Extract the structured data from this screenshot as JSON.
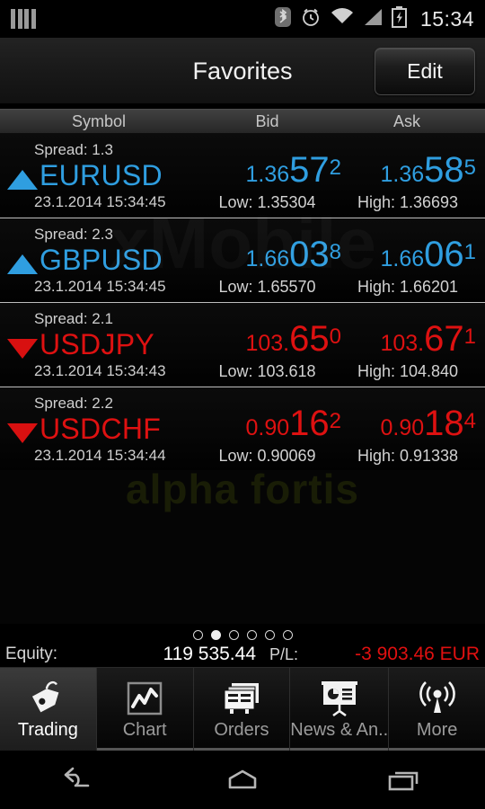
{
  "statusbar": {
    "left_icon": "signal-bars-icon",
    "icons": [
      "bluetooth-icon",
      "alarm-icon",
      "wifi-icon",
      "cell-signal-icon",
      "battery-charging-icon"
    ],
    "clock": "15:34"
  },
  "header": {
    "title": "Favorites",
    "edit_label": "Edit"
  },
  "columns": {
    "symbol": "Symbol",
    "bid": "Bid",
    "ask": "Ask"
  },
  "watermarks": {
    "app": "xMobile",
    "broker": "alpha fortis"
  },
  "colors": {
    "up": "#2f9ee0",
    "down": "#de1111",
    "negative": "#e01010"
  },
  "quotes": [
    {
      "symbol": "EURUSD",
      "spread_label": "Spread: 1.3",
      "timestamp": "23.1.2014 15:34:45",
      "direction": "up",
      "bid": {
        "small": "1.36",
        "big": "57",
        "sup": "2"
      },
      "ask": {
        "small": "1.36",
        "big": "58",
        "sup": "5"
      },
      "low": "Low: 1.35304",
      "high": "High: 1.36693"
    },
    {
      "symbol": "GBPUSD",
      "spread_label": "Spread: 2.3",
      "timestamp": "23.1.2014 15:34:45",
      "direction": "up",
      "bid": {
        "small": "1.66",
        "big": "03",
        "sup": "8"
      },
      "ask": {
        "small": "1.66",
        "big": "06",
        "sup": "1"
      },
      "low": "Low: 1.65570",
      "high": "High: 1.66201"
    },
    {
      "symbol": "USDJPY",
      "spread_label": "Spread: 2.1",
      "timestamp": "23.1.2014 15:34:43",
      "direction": "down",
      "bid": {
        "small": "103.",
        "big": "65",
        "sup": "0"
      },
      "ask": {
        "small": "103.",
        "big": "67",
        "sup": "1"
      },
      "low": "Low: 103.618",
      "high": "High: 104.840"
    },
    {
      "symbol": "USDCHF",
      "spread_label": "Spread: 2.2",
      "timestamp": "23.1.2014 15:34:44",
      "direction": "down",
      "bid": {
        "small": "0.90",
        "big": "16",
        "sup": "2"
      },
      "ask": {
        "small": "0.90",
        "big": "18",
        "sup": "4"
      },
      "low": "Low: 0.90069",
      "high": "High: 0.91338"
    }
  ],
  "pager": {
    "total": 6,
    "active_index": 1
  },
  "account": {
    "equity_label": "Equity:",
    "equity_value": "119 535.44",
    "pl_label": "P/L:",
    "pl_value": "-3 903.46 EUR"
  },
  "tabs": [
    {
      "label": "Trading",
      "icon": "price-tag-icon",
      "active": true
    },
    {
      "label": "Chart",
      "icon": "line-chart-icon",
      "active": false
    },
    {
      "label": "Orders",
      "icon": "stacked-cards-icon",
      "active": false
    },
    {
      "label": "News & An..",
      "icon": "presentation-icon",
      "active": false
    },
    {
      "label": "More",
      "icon": "broadcast-icon",
      "active": false
    }
  ],
  "navbar": {
    "back": "back-icon",
    "home": "home-icon",
    "recents": "recents-icon"
  }
}
